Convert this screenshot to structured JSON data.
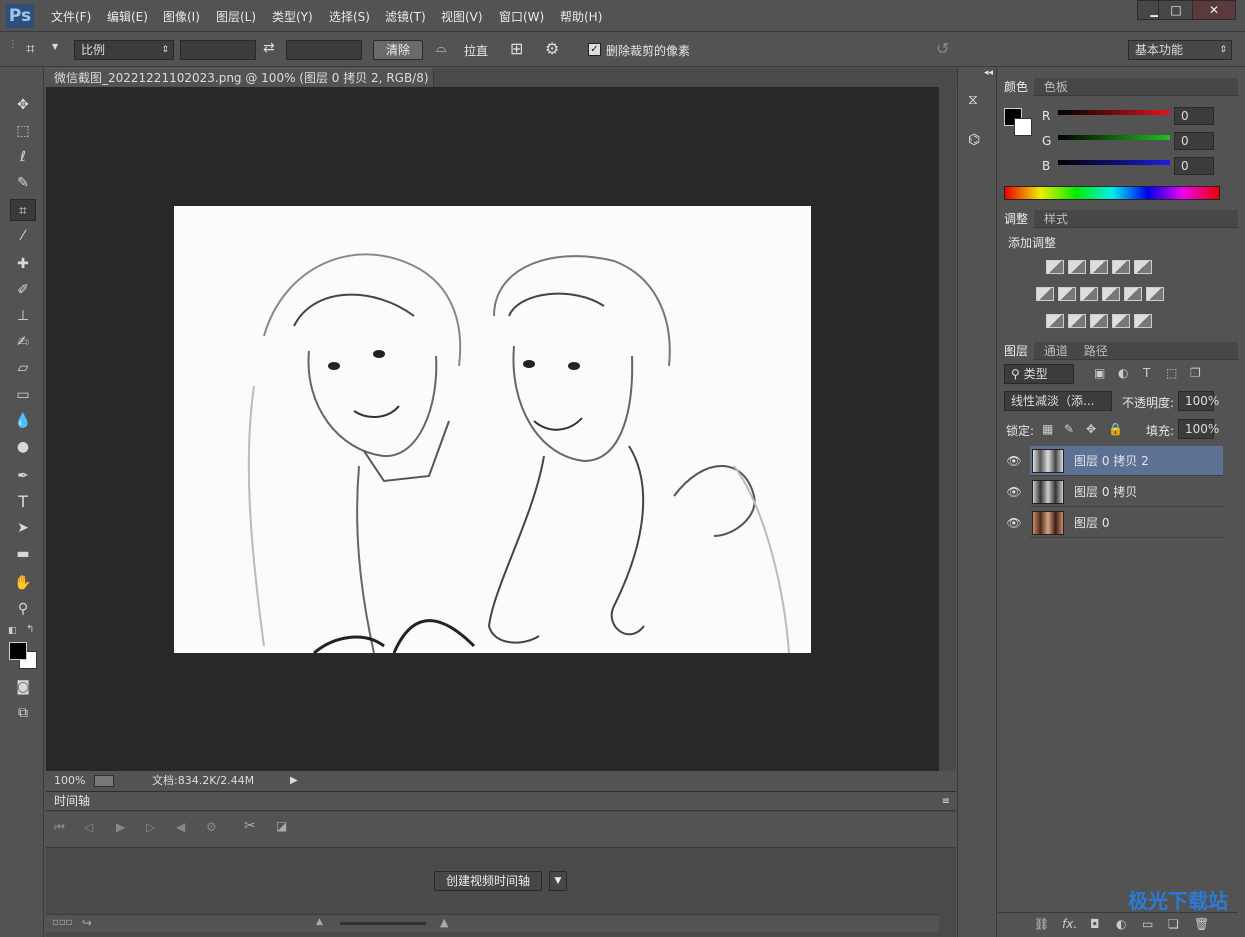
{
  "app": {
    "logo": "Ps"
  },
  "menu": [
    "文件(F)",
    "编辑(E)",
    "图像(I)",
    "图层(L)",
    "类型(Y)",
    "选择(S)",
    "滤镜(T)",
    "视图(V)",
    "窗口(W)",
    "帮助(H)"
  ],
  "window_controls": {
    "minimize": "▁",
    "maximize": "□",
    "close": "✕"
  },
  "options": {
    "ratio_label": "比例",
    "clear_label": "清除",
    "straighten_label": "拉直",
    "delete_cropped_label": "删除裁剪的像素",
    "delete_cropped_checked": true,
    "workspace_label": "基本功能"
  },
  "document": {
    "tab_title": "微信截图_20221221102023.png @ 100% (图层 0 拷贝 2, RGB/8) *",
    "close": "×"
  },
  "status": {
    "zoom": "100%",
    "doc_info": "文档:834.2K/2.44M"
  },
  "timeline": {
    "title": "时间轴",
    "create_label": "创建视频时间轴"
  },
  "color_panel": {
    "tabs": [
      "颜色",
      "色板"
    ],
    "channels": [
      {
        "name": "R",
        "value": "0",
        "color": "#e0151b"
      },
      {
        "name": "G",
        "value": "0",
        "color": "#1ec21e"
      },
      {
        "name": "B",
        "value": "0",
        "color": "#1d1ddf"
      }
    ]
  },
  "adjust_panel": {
    "tabs": [
      "调整",
      "样式"
    ],
    "add_label": "添加调整"
  },
  "layers_panel": {
    "tabs": [
      "图层",
      "通道",
      "路径"
    ],
    "filter_label": "类型",
    "blend_mode": "线性减淡（添...",
    "opacity_label": "不透明度:",
    "opacity_value": "100%",
    "lock_label": "锁定:",
    "fill_label": "填充:",
    "fill_value": "100%",
    "layers": [
      {
        "name": "图层 0 拷贝 2",
        "selected": true,
        "visible": true
      },
      {
        "name": "图层 0 拷贝",
        "selected": false,
        "visible": true
      },
      {
        "name": "图层 0",
        "selected": false,
        "visible": true
      }
    ],
    "footer_fx": "fx."
  },
  "watermark": "极光下载站"
}
